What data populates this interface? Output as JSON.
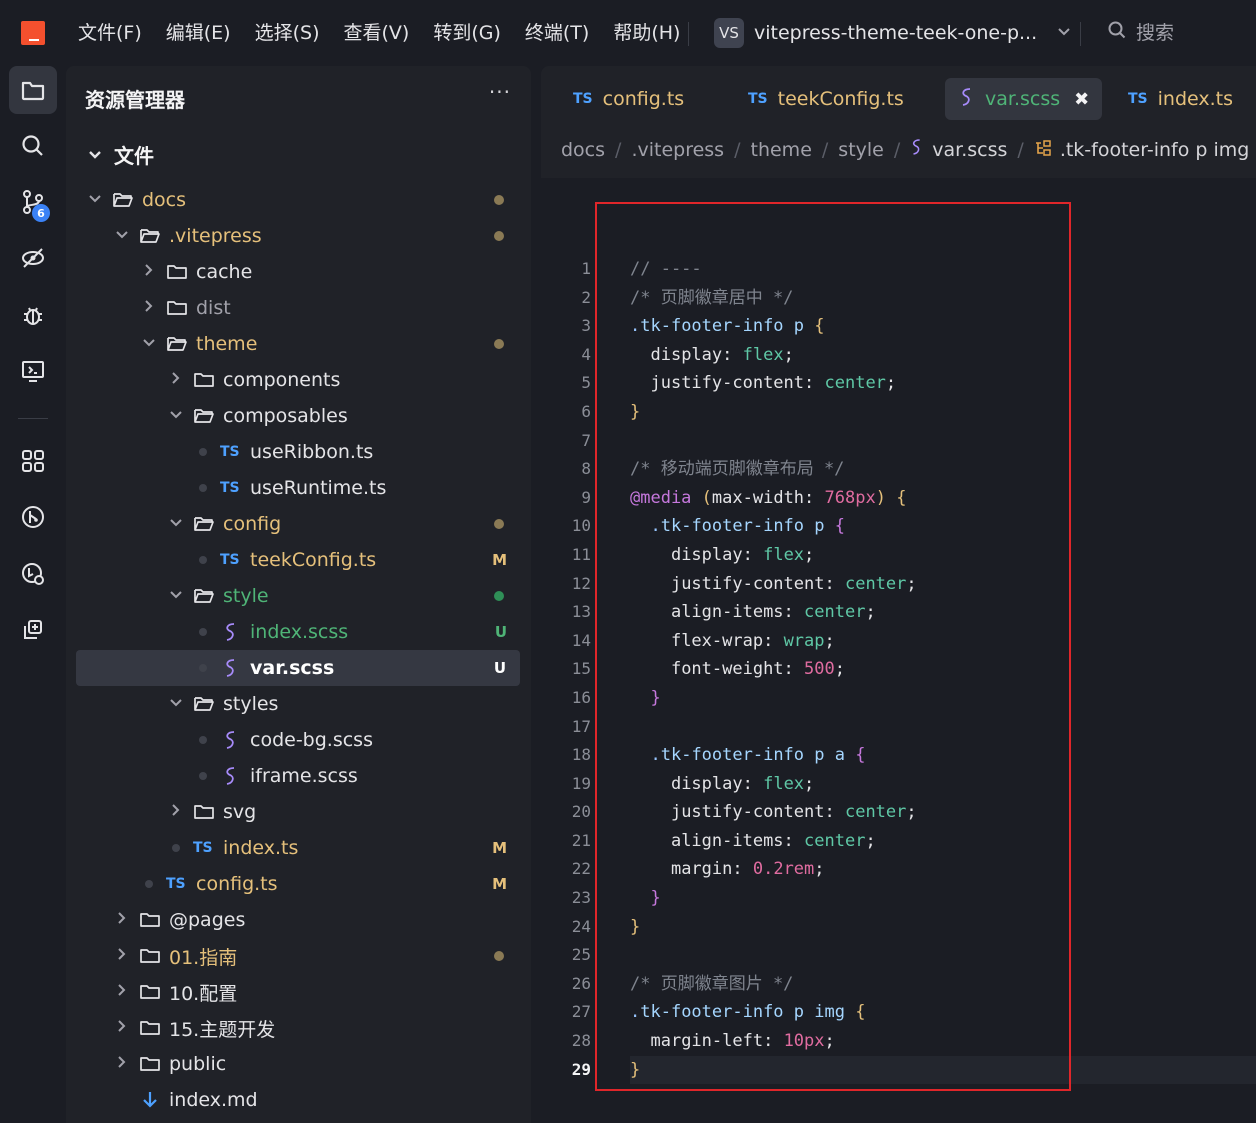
{
  "titlebar": {
    "menu": [
      "文件(F)",
      "编辑(E)",
      "选择(S)",
      "查看(V)",
      "转到(G)",
      "终端(T)",
      "帮助(H)"
    ],
    "project_badge": "VS",
    "project_name": "vitepress-theme-teek-one-p...",
    "search_label": "搜索"
  },
  "activity": {
    "source_control_badge": "6"
  },
  "sidebar": {
    "title": "资源管理器",
    "more": "···",
    "section": "文件",
    "tree": [
      {
        "label": "docs",
        "indent": 0,
        "kind": "folder-open",
        "chev": "down",
        "status": "dot",
        "color": "yellow"
      },
      {
        "label": ".vitepress",
        "indent": 1,
        "kind": "folder-open",
        "chev": "down",
        "status": "dot",
        "color": "yellow"
      },
      {
        "label": "cache",
        "indent": 2,
        "kind": "folder",
        "chev": "right",
        "status": "",
        "color": "normal"
      },
      {
        "label": "dist",
        "indent": 2,
        "kind": "folder",
        "chev": "right",
        "status": "",
        "color": "dim"
      },
      {
        "label": "theme",
        "indent": 2,
        "kind": "folder-open",
        "chev": "down",
        "status": "dot",
        "color": "yellow"
      },
      {
        "label": "components",
        "indent": 3,
        "kind": "folder",
        "chev": "right",
        "status": "",
        "color": "normal"
      },
      {
        "label": "composables",
        "indent": 3,
        "kind": "folder-open",
        "chev": "down",
        "status": "",
        "color": "normal"
      },
      {
        "label": "useRibbon.ts",
        "indent": 4,
        "kind": "ts",
        "chev": "",
        "status": "",
        "color": "normal"
      },
      {
        "label": "useRuntime.ts",
        "indent": 4,
        "kind": "ts",
        "chev": "",
        "status": "",
        "color": "normal"
      },
      {
        "label": "config",
        "indent": 3,
        "kind": "folder-open",
        "chev": "down",
        "status": "dot",
        "color": "yellow"
      },
      {
        "label": "teekConfig.ts",
        "indent": 4,
        "kind": "ts",
        "chev": "",
        "status": "M",
        "color": "yellow"
      },
      {
        "label": "style",
        "indent": 3,
        "kind": "folder-open",
        "chev": "down",
        "status": "dot-green",
        "color": "green"
      },
      {
        "label": "index.scss",
        "indent": 4,
        "kind": "scss",
        "chev": "",
        "status": "U",
        "color": "green"
      },
      {
        "label": "var.scss",
        "indent": 4,
        "kind": "scss",
        "chev": "",
        "status": "U",
        "color": "bright",
        "selected": true
      },
      {
        "label": "styles",
        "indent": 3,
        "kind": "folder-open",
        "chev": "down",
        "status": "",
        "color": "normal"
      },
      {
        "label": "code-bg.scss",
        "indent": 4,
        "kind": "scss",
        "chev": "",
        "status": "",
        "color": "normal"
      },
      {
        "label": "iframe.scss",
        "indent": 4,
        "kind": "scss",
        "chev": "",
        "status": "",
        "color": "normal"
      },
      {
        "label": "svg",
        "indent": 3,
        "kind": "folder",
        "chev": "right",
        "status": "",
        "color": "normal"
      },
      {
        "label": "index.ts",
        "indent": 3,
        "kind": "ts",
        "chev": "",
        "status": "M",
        "color": "yellow"
      },
      {
        "label": "config.ts",
        "indent": 2,
        "kind": "ts",
        "chev": "",
        "status": "M",
        "color": "yellow"
      },
      {
        "label": "@pages",
        "indent": 1,
        "kind": "folder",
        "chev": "right",
        "status": "",
        "color": "normal"
      },
      {
        "label": "01.指南",
        "indent": 1,
        "kind": "folder",
        "chev": "right",
        "status": "dot",
        "color": "yellow"
      },
      {
        "label": "10.配置",
        "indent": 1,
        "kind": "folder",
        "chev": "right",
        "status": "",
        "color": "normal"
      },
      {
        "label": "15.主题开发",
        "indent": 1,
        "kind": "folder",
        "chev": "right",
        "status": "",
        "color": "normal"
      },
      {
        "label": "public",
        "indent": 1,
        "kind": "folder",
        "chev": "right",
        "status": "",
        "color": "normal"
      },
      {
        "label": "index.md",
        "indent": 1,
        "kind": "md",
        "chev": "",
        "status": "",
        "color": "normal"
      }
    ]
  },
  "editor": {
    "tabs": [
      {
        "label": "config.ts",
        "kind": "ts",
        "active": false
      },
      {
        "label": "teekConfig.ts",
        "kind": "ts",
        "active": false
      },
      {
        "label": "var.scss",
        "kind": "scss",
        "active": true
      },
      {
        "label": "index.ts",
        "kind": "ts",
        "active": false
      }
    ],
    "close_glyph": "✖",
    "breadcrumb": [
      "docs",
      ".vitepress",
      "theme",
      "style",
      "var.scss",
      ".tk-footer-info p img"
    ],
    "current_line": 29,
    "code": [
      "// ----",
      "/* 页脚徽章居中 */",
      ".tk-footer-info p {",
      "  display: flex;",
      "  justify-content: center;",
      "}",
      "",
      "/* 移动端页脚徽章布局 */",
      "@media (max-width: 768px) {",
      "  .tk-footer-info p {",
      "    display: flex;",
      "    justify-content: center;",
      "    align-items: center;",
      "    flex-wrap: wrap;",
      "    font-weight: 500;",
      "  }",
      "",
      "  .tk-footer-info p a {",
      "    display: flex;",
      "    justify-content: center;",
      "    align-items: center;",
      "    margin: 0.2rem;",
      "  }",
      "}",
      "",
      "/* 页脚徽章图片 */",
      ".tk-footer-info p img {",
      "  margin-left: 10px;",
      "}"
    ]
  },
  "colors": {
    "accent": "#4ea1ff",
    "modified": "#e5c07b",
    "untracked": "#4fb477",
    "highlight_border": "#e0262a"
  }
}
